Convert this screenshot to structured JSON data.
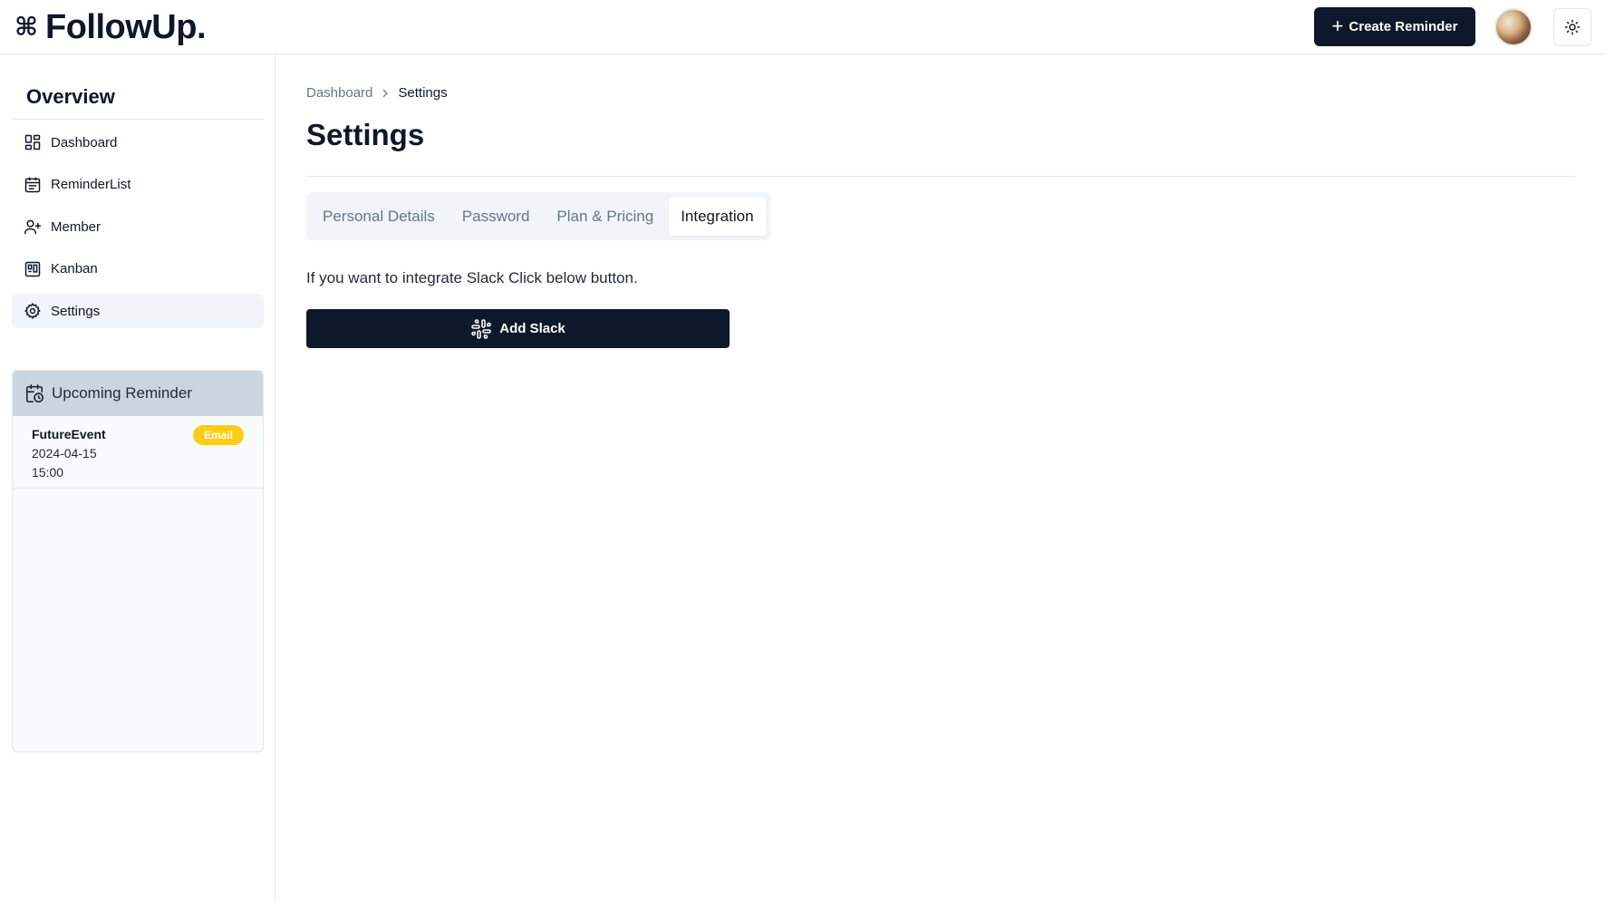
{
  "app": {
    "logo_icon": "⌘",
    "name": "FollowUp."
  },
  "header": {
    "create_button_label": "Create Reminder",
    "create_button_icon": "plus-icon",
    "theme_toggle_icon": "sun-icon"
  },
  "sidebar": {
    "title": "Overview",
    "items": [
      {
        "label": "Dashboard",
        "icon": "grid-icon",
        "active": false
      },
      {
        "label": "ReminderList",
        "icon": "calendar-icon",
        "active": false
      },
      {
        "label": "Member",
        "icon": "user-plus-icon",
        "active": false
      },
      {
        "label": "Kanban",
        "icon": "kanban-icon",
        "active": false
      },
      {
        "label": "Settings",
        "icon": "gear-icon",
        "active": true
      }
    ],
    "upcoming": {
      "title": "Upcoming Reminder",
      "items": [
        {
          "name": "FutureEvent",
          "date": "2024-04-15",
          "time": "15:00",
          "badge": "Email"
        }
      ]
    }
  },
  "main": {
    "breadcrumb": {
      "parent": "Dashboard",
      "current": "Settings"
    },
    "title": "Settings",
    "tabs": [
      {
        "label": "Personal Details",
        "active": false
      },
      {
        "label": "Password",
        "active": false
      },
      {
        "label": "Plan & Pricing",
        "active": false
      },
      {
        "label": "Integration",
        "active": true
      }
    ],
    "integration_text": "If you want to integrate Slack Click below button.",
    "slack_button_label": "Add Slack"
  },
  "colors": {
    "primary": "#0f172a",
    "badge": "#facc15",
    "muted": "#64748b",
    "active_bg": "#f1f5f9",
    "upcoming_header": "#cbd5e1"
  }
}
